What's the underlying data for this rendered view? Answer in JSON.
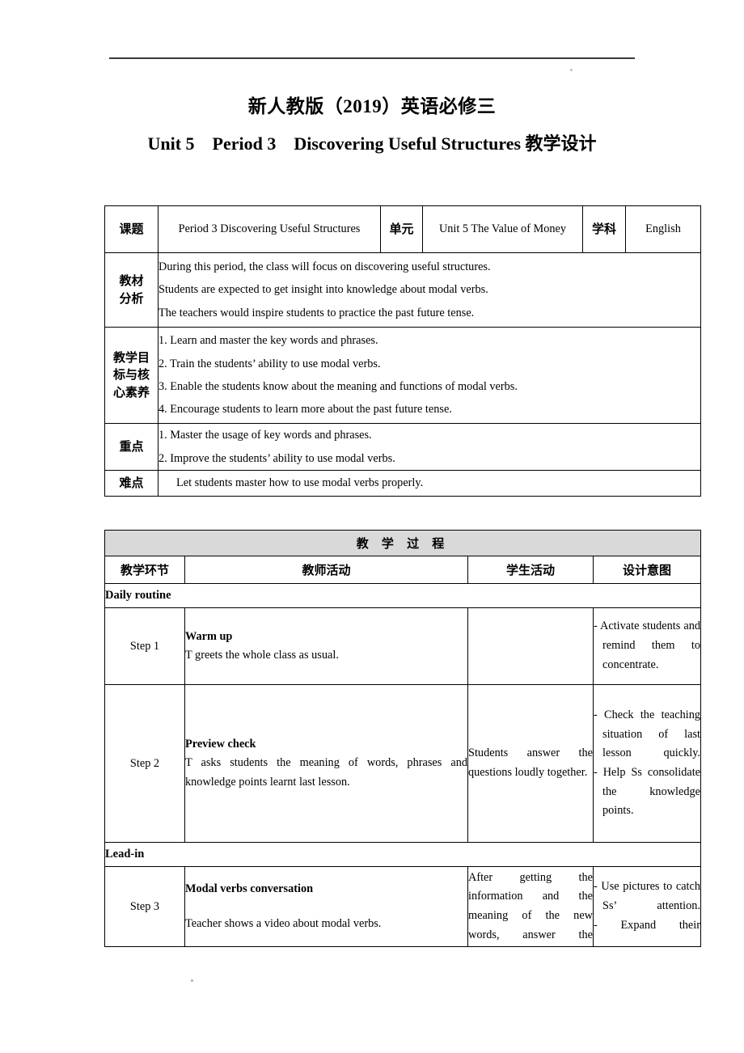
{
  "document": {
    "title_main": "新人教版（2019）英语必修三",
    "title_sub_parts": [
      "Unit 5",
      "Period 3",
      "Discovering Useful Structures 教学设计"
    ]
  },
  "info_table": {
    "row_topic": {
      "label": "课题",
      "value": "Period 3 Discovering Useful Structures",
      "label2": "单元",
      "value2": "Unit 5 The Value of Money",
      "label3": "学科",
      "value3": "English"
    },
    "row_analysis": {
      "label": "教材\n分析",
      "label_line1": "教材",
      "label_line2": "分析",
      "lines": [
        "During this period, the class will focus on discovering useful structures.",
        "Students are expected to get insight into knowledge about modal verbs.",
        "The teachers would inspire students to practice the past future tense."
      ]
    },
    "row_objectives": {
      "label_line1": "教学目",
      "label_line2": "标与核",
      "label_line3": "心素养",
      "lines": [
        "1. Learn and master the key words and phrases.",
        "2. Train the students’ ability to use modal verbs.",
        "3. Enable the students know about the meaning and functions of modal verbs.",
        "4. Encourage students to learn more about the past future tense."
      ]
    },
    "row_key": {
      "label": "重点",
      "lines": [
        "1. Master the usage of key words and phrases.",
        "2. Improve the students’ ability to use modal verbs."
      ]
    },
    "row_difficult": {
      "label": "难点",
      "lines": [
        "Let students master how to use modal verbs properly."
      ]
    }
  },
  "process_table": {
    "banner": "教  学  过  程",
    "headers": [
      "教学环节",
      "教师活动",
      "学生活动",
      "设计意图"
    ],
    "sections": [
      {
        "label": "Daily routine"
      },
      {
        "label": "Lead-in"
      }
    ],
    "steps": [
      {
        "step": "Step 1",
        "teacher_title": "Warm up",
        "teacher_body": "T greets the whole class as usual.",
        "student": "",
        "intents": [
          "- Activate students and remind them to concentrate."
        ]
      },
      {
        "step": "Step 2",
        "teacher_title": "Preview check",
        "teacher_body": "T asks students the meaning of words, phrases and knowledge points learnt last lesson.",
        "student": "Students answer the questions loudly together.",
        "intents": [
          "- Check the teaching situation of last lesson quickly.",
          "- Help Ss consolidate the knowledge points."
        ]
      },
      {
        "step": "Step 3",
        "teacher_title": "Modal verbs conversation",
        "teacher_body": "Teacher shows a video about modal verbs.",
        "student": "After getting the information and the meaning of the new words, answer the",
        "intents": [
          "- Use pictures to catch Ss’ attention.",
          "- Expand their"
        ]
      }
    ]
  },
  "colors": {
    "banner_background": "#d9d9d9",
    "border": "#000000",
    "rule": "#3a3a3a"
  }
}
